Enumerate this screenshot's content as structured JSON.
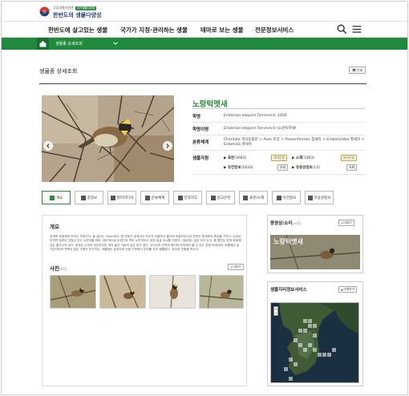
{
  "header": {
    "org": "국립생물자원관",
    "badge": "국가생물다양성",
    "site_title": "한반도의 생물다양성"
  },
  "nav": {
    "items": [
      "한반도에 살고있는 생물",
      "국가가 지정·관리하는 생물",
      "테마로 보는 생물",
      "전문정보서비스"
    ]
  },
  "breadcrumb": {
    "current": "생물종 상세조회"
  },
  "page": {
    "title": "생물종 상세조회",
    "print_label": "인쇄"
  },
  "species": {
    "korean_name": "노랑턱멧새",
    "labels": {
      "scientific": "학명",
      "synonym": "학명이명",
      "taxonomy": "분류체계",
      "resources": "생물자원"
    },
    "scientific_name": "Emberiza elegans Temminck, 1836",
    "synonym": "Emberiza elegans Temminck (노랑턱멧새)",
    "taxonomy": "Chordata 척삭동물문 > Aves 조강 > Passeriformes 참새목 > Emberizidae 멧새과 > Emberiza 멧새속",
    "resources": [
      {
        "label": "표본",
        "count": "(1683)",
        "tag": "대여신청"
      },
      {
        "label": "소재",
        "count": "(1063)",
        "tag": "분양신청"
      },
      {
        "label": "유전정보",
        "count": "(1833)",
        "tag": "조회"
      },
      {
        "label": "유용성정보",
        "count": "(13)",
        "tag": "조회"
      }
    ]
  },
  "tabs": [
    "개요",
    "종정보",
    "멀티미디어",
    "분류체계",
    "분포지도",
    "참고문헌",
    "표본/소재",
    "유전정보",
    "유용성정보"
  ],
  "overview": {
    "title": "개요",
    "text": "참새목 멧새과에 속하는 조류이다. 몸 길이는 16cm이다. 몸 전체가 갈색이고 부리가 두툼하고 짧으며 바깥꼬리깃이 흰색인 멧새류의 특징을 가진다. 수컷은 뚜렷한 뒷머리 깃털이 있는 노란색을 띠며, 대조적으로 눈썹선과 멱이 노란색이고 검은 얼굴 무늬를 가졌다. 가슴에는 검은 띠가 있고, 몸 윗면은 밤색 바탕에 검은 줄무늬가 있다. 암컷은 수컷과 비슷하지만 색이 엷고 가슴의 검은 띠가 없다. 우리나라 전역의 평지와 산지에서 볼 수 있는 흔한 텃새이며, 여름에는 숲 가장자리와 관목이 많은 곳에서 번식하고, 겨울에는 농경지와 산림 주변에서 무리를 지어 생활한다. 씨앗과 곤충을 먹는다.",
    "photos_title": "사진",
    "photos_count": "(4건)",
    "more_label": "더보기"
  },
  "media": {
    "title": "동영상/소리",
    "count": "(10건)",
    "more_label": "더보기",
    "video_caption": "노랑턱멧새"
  },
  "geo": {
    "title": "생물지리정보서비스",
    "more_label": "크게보기"
  },
  "colors": {
    "brand_green": "#1f8a3c",
    "species_green": "#2e8b3e",
    "navy": "#1f3d7a"
  }
}
